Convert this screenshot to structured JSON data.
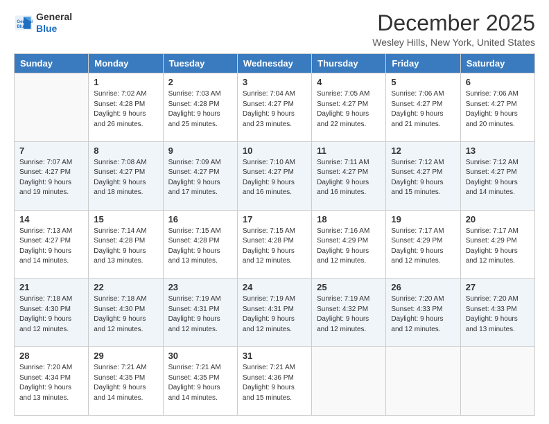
{
  "logo": {
    "line1": "General",
    "line2": "Blue"
  },
  "title": "December 2025",
  "subtitle": "Wesley Hills, New York, United States",
  "days_of_week": [
    "Sunday",
    "Monday",
    "Tuesday",
    "Wednesday",
    "Thursday",
    "Friday",
    "Saturday"
  ],
  "weeks": [
    [
      {
        "day": "",
        "sunrise": "",
        "sunset": "",
        "daylight": ""
      },
      {
        "day": "1",
        "sunrise": "Sunrise: 7:02 AM",
        "sunset": "Sunset: 4:28 PM",
        "daylight": "Daylight: 9 hours and 26 minutes."
      },
      {
        "day": "2",
        "sunrise": "Sunrise: 7:03 AM",
        "sunset": "Sunset: 4:28 PM",
        "daylight": "Daylight: 9 hours and 25 minutes."
      },
      {
        "day": "3",
        "sunrise": "Sunrise: 7:04 AM",
        "sunset": "Sunset: 4:27 PM",
        "daylight": "Daylight: 9 hours and 23 minutes."
      },
      {
        "day": "4",
        "sunrise": "Sunrise: 7:05 AM",
        "sunset": "Sunset: 4:27 PM",
        "daylight": "Daylight: 9 hours and 22 minutes."
      },
      {
        "day": "5",
        "sunrise": "Sunrise: 7:06 AM",
        "sunset": "Sunset: 4:27 PM",
        "daylight": "Daylight: 9 hours and 21 minutes."
      },
      {
        "day": "6",
        "sunrise": "Sunrise: 7:06 AM",
        "sunset": "Sunset: 4:27 PM",
        "daylight": "Daylight: 9 hours and 20 minutes."
      }
    ],
    [
      {
        "day": "7",
        "sunrise": "Sunrise: 7:07 AM",
        "sunset": "Sunset: 4:27 PM",
        "daylight": "Daylight: 9 hours and 19 minutes."
      },
      {
        "day": "8",
        "sunrise": "Sunrise: 7:08 AM",
        "sunset": "Sunset: 4:27 PM",
        "daylight": "Daylight: 9 hours and 18 minutes."
      },
      {
        "day": "9",
        "sunrise": "Sunrise: 7:09 AM",
        "sunset": "Sunset: 4:27 PM",
        "daylight": "Daylight: 9 hours and 17 minutes."
      },
      {
        "day": "10",
        "sunrise": "Sunrise: 7:10 AM",
        "sunset": "Sunset: 4:27 PM",
        "daylight": "Daylight: 9 hours and 16 minutes."
      },
      {
        "day": "11",
        "sunrise": "Sunrise: 7:11 AM",
        "sunset": "Sunset: 4:27 PM",
        "daylight": "Daylight: 9 hours and 16 minutes."
      },
      {
        "day": "12",
        "sunrise": "Sunrise: 7:12 AM",
        "sunset": "Sunset: 4:27 PM",
        "daylight": "Daylight: 9 hours and 15 minutes."
      },
      {
        "day": "13",
        "sunrise": "Sunrise: 7:12 AM",
        "sunset": "Sunset: 4:27 PM",
        "daylight": "Daylight: 9 hours and 14 minutes."
      }
    ],
    [
      {
        "day": "14",
        "sunrise": "Sunrise: 7:13 AM",
        "sunset": "Sunset: 4:27 PM",
        "daylight": "Daylight: 9 hours and 14 minutes."
      },
      {
        "day": "15",
        "sunrise": "Sunrise: 7:14 AM",
        "sunset": "Sunset: 4:28 PM",
        "daylight": "Daylight: 9 hours and 13 minutes."
      },
      {
        "day": "16",
        "sunrise": "Sunrise: 7:15 AM",
        "sunset": "Sunset: 4:28 PM",
        "daylight": "Daylight: 9 hours and 13 minutes."
      },
      {
        "day": "17",
        "sunrise": "Sunrise: 7:15 AM",
        "sunset": "Sunset: 4:28 PM",
        "daylight": "Daylight: 9 hours and 12 minutes."
      },
      {
        "day": "18",
        "sunrise": "Sunrise: 7:16 AM",
        "sunset": "Sunset: 4:29 PM",
        "daylight": "Daylight: 9 hours and 12 minutes."
      },
      {
        "day": "19",
        "sunrise": "Sunrise: 7:17 AM",
        "sunset": "Sunset: 4:29 PM",
        "daylight": "Daylight: 9 hours and 12 minutes."
      },
      {
        "day": "20",
        "sunrise": "Sunrise: 7:17 AM",
        "sunset": "Sunset: 4:29 PM",
        "daylight": "Daylight: 9 hours and 12 minutes."
      }
    ],
    [
      {
        "day": "21",
        "sunrise": "Sunrise: 7:18 AM",
        "sunset": "Sunset: 4:30 PM",
        "daylight": "Daylight: 9 hours and 12 minutes."
      },
      {
        "day": "22",
        "sunrise": "Sunrise: 7:18 AM",
        "sunset": "Sunset: 4:30 PM",
        "daylight": "Daylight: 9 hours and 12 minutes."
      },
      {
        "day": "23",
        "sunrise": "Sunrise: 7:19 AM",
        "sunset": "Sunset: 4:31 PM",
        "daylight": "Daylight: 9 hours and 12 minutes."
      },
      {
        "day": "24",
        "sunrise": "Sunrise: 7:19 AM",
        "sunset": "Sunset: 4:31 PM",
        "daylight": "Daylight: 9 hours and 12 minutes."
      },
      {
        "day": "25",
        "sunrise": "Sunrise: 7:19 AM",
        "sunset": "Sunset: 4:32 PM",
        "daylight": "Daylight: 9 hours and 12 minutes."
      },
      {
        "day": "26",
        "sunrise": "Sunrise: 7:20 AM",
        "sunset": "Sunset: 4:33 PM",
        "daylight": "Daylight: 9 hours and 12 minutes."
      },
      {
        "day": "27",
        "sunrise": "Sunrise: 7:20 AM",
        "sunset": "Sunset: 4:33 PM",
        "daylight": "Daylight: 9 hours and 13 minutes."
      }
    ],
    [
      {
        "day": "28",
        "sunrise": "Sunrise: 7:20 AM",
        "sunset": "Sunset: 4:34 PM",
        "daylight": "Daylight: 9 hours and 13 minutes."
      },
      {
        "day": "29",
        "sunrise": "Sunrise: 7:21 AM",
        "sunset": "Sunset: 4:35 PM",
        "daylight": "Daylight: 9 hours and 14 minutes."
      },
      {
        "day": "30",
        "sunrise": "Sunrise: 7:21 AM",
        "sunset": "Sunset: 4:35 PM",
        "daylight": "Daylight: 9 hours and 14 minutes."
      },
      {
        "day": "31",
        "sunrise": "Sunrise: 7:21 AM",
        "sunset": "Sunset: 4:36 PM",
        "daylight": "Daylight: 9 hours and 15 minutes."
      },
      {
        "day": "",
        "sunrise": "",
        "sunset": "",
        "daylight": ""
      },
      {
        "day": "",
        "sunrise": "",
        "sunset": "",
        "daylight": ""
      },
      {
        "day": "",
        "sunrise": "",
        "sunset": "",
        "daylight": ""
      }
    ]
  ]
}
